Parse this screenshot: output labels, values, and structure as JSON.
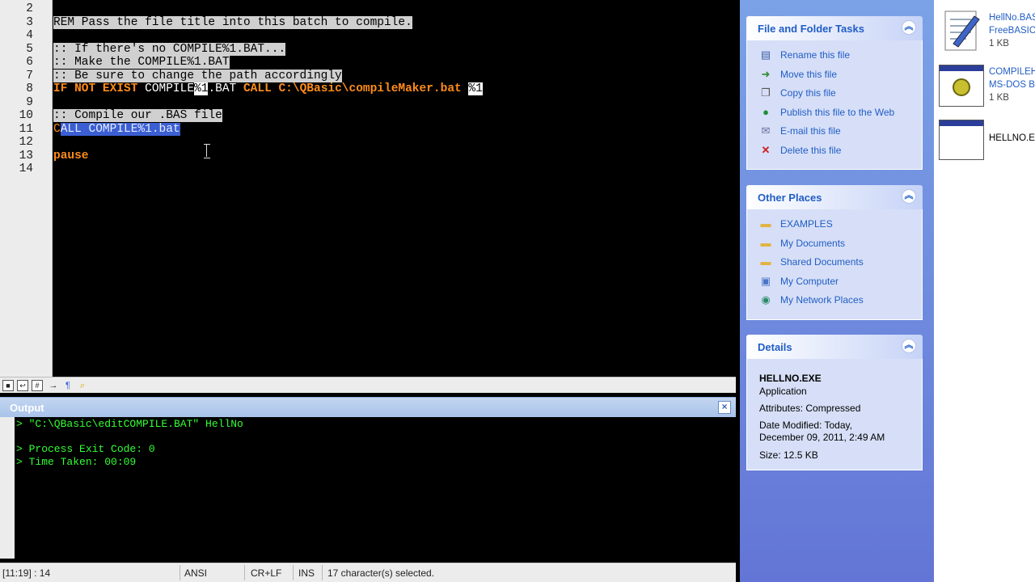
{
  "editor": {
    "line_numbers": [
      "2",
      "3",
      "4",
      "5",
      "6",
      "7",
      "8",
      "9",
      "10",
      "11",
      "12",
      "13",
      "14"
    ],
    "line3": "REM Pass the file title into this batch to compile.",
    "line5": ":: If there's no COMPILE%1.BAT...",
    "line6": ":: Make the COMPILE%1.BAT",
    "line7": ":: Be sure to change the path accordingly",
    "line8": {
      "if": "IF NOT EXIST",
      "compile": " COMPILE",
      "var": "%1",
      "bat": ".BAT",
      "call": " CALL",
      "path": " C:\\QBasic\\compileMaker.bat ",
      "arg": "%1"
    },
    "line10": ":: Compile our .BAS file",
    "line11_first": "C",
    "line11_rest": "ALL COMPILE%1.bat",
    "line13": "pause"
  },
  "toolbar": {
    "icons": [
      "stop-icon",
      "undo-icon",
      "grid-icon",
      "arrow-icon",
      "pilcrow-icon",
      "pin-icon"
    ],
    "arrow_glyph": "→",
    "pilcrow_glyph": "¶",
    "pin_glyph": "⌕"
  },
  "output": {
    "title": "Output",
    "close_glyph": "×",
    "lines": [
      "> \"C:\\QBasic\\editCOMPILE.BAT\" HellNo",
      "",
      "> Process Exit Code: 0",
      "> Time Taken: 00:09"
    ]
  },
  "status": {
    "position": "[11:19] : 14",
    "encoding": "ANSI",
    "line_endings": "CR+LF",
    "mode": "INS",
    "selection": "17 character(s) selected."
  },
  "taskpane": {
    "collapse_glyph": "︽",
    "file_tasks": {
      "title": "File and Folder Tasks",
      "items": [
        {
          "label": "Rename this file",
          "icon": "rename-icon"
        },
        {
          "label": "Move this file",
          "icon": "move-icon"
        },
        {
          "label": "Copy this file",
          "icon": "copy-icon"
        },
        {
          "label": "Publish this file to the Web",
          "icon": "publish-web-icon"
        },
        {
          "label": "E-mail this file",
          "icon": "email-icon"
        },
        {
          "label": "Delete this file",
          "icon": "delete-icon"
        }
      ]
    },
    "other_places": {
      "title": "Other Places",
      "items": [
        {
          "label": "EXAMPLES",
          "icon": "folder-icon"
        },
        {
          "label": "My Documents",
          "icon": "my-documents-icon"
        },
        {
          "label": "Shared Documents",
          "icon": "folder-icon"
        },
        {
          "label": "My Computer",
          "icon": "computer-icon"
        },
        {
          "label": "My Network Places",
          "icon": "network-icon"
        }
      ]
    },
    "details": {
      "title": "Details",
      "name": "HELLNO.EXE",
      "type": "Application",
      "attributes": "Attributes: Compressed",
      "modified_label": "Date Modified: Today,",
      "modified_date": "December 09, 2011, 2:49 AM",
      "size": "Size: 12.5 KB"
    }
  },
  "files": [
    {
      "name": "HellNo.BAS",
      "type": "FreeBASIC",
      "size": "1 KB",
      "icon": "bas-file-icon"
    },
    {
      "name": "COMPILEH",
      "type": "MS-DOS B",
      "size": "1 KB",
      "icon": "batch-file-icon"
    },
    {
      "name": "HELLNO.E",
      "icon": "exe-file-icon"
    }
  ],
  "colors": {
    "keyword": "#ff8c1a",
    "comment_highlight": "#d0d0d0",
    "selection": "#3b5fd3",
    "output_text": "#33ff33",
    "link_blue": "#215dc6"
  }
}
